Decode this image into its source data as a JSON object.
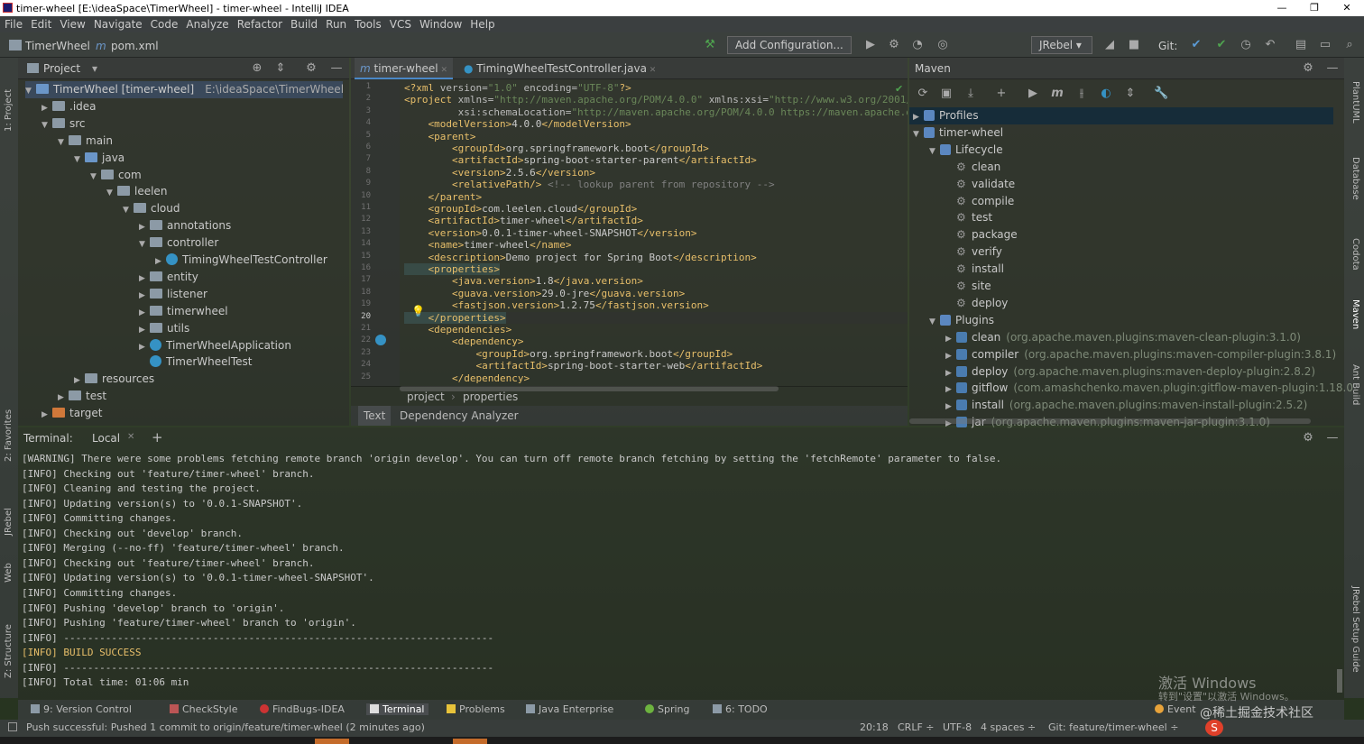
{
  "window": {
    "title": "timer-wheel [E:\\ideaSpace\\TimerWheel] - timer-wheel - IntelliJ IDEA"
  },
  "menu": [
    "File",
    "Edit",
    "View",
    "Navigate",
    "Code",
    "Analyze",
    "Refactor",
    "Build",
    "Run",
    "Tools",
    "VCS",
    "Window",
    "Help"
  ],
  "nav": {
    "project": "TimerWheel",
    "file": "pom.xml",
    "add_config": "Add Configuration...",
    "jrebel": "JRebel",
    "git_label": "Git:"
  },
  "project_panel": {
    "title": "Project",
    "rows": [
      {
        "depth": 0,
        "arrow": "▼",
        "icon": "module",
        "text": "TimerWheel [timer-wheel]",
        "extra": "E:\\ideaSpace\\TimerWheel"
      },
      {
        "depth": 1,
        "arrow": "▶",
        "icon": "folder",
        "text": ".idea",
        "extra": ""
      },
      {
        "depth": 1,
        "arrow": "▼",
        "icon": "folder",
        "text": "src",
        "extra": ""
      },
      {
        "depth": 2,
        "arrow": "▼",
        "icon": "folder",
        "text": "main",
        "extra": ""
      },
      {
        "depth": 3,
        "arrow": "▼",
        "icon": "blue",
        "text": "java",
        "extra": ""
      },
      {
        "depth": 4,
        "arrow": "▼",
        "icon": "folder",
        "text": "com",
        "extra": ""
      },
      {
        "depth": 5,
        "arrow": "▼",
        "icon": "folder",
        "text": "leelen",
        "extra": ""
      },
      {
        "depth": 6,
        "arrow": "▼",
        "icon": "folder",
        "text": "cloud",
        "extra": ""
      },
      {
        "depth": 7,
        "arrow": "▶",
        "icon": "folder",
        "text": "annotations",
        "extra": ""
      },
      {
        "depth": 7,
        "arrow": "▼",
        "icon": "folder",
        "text": "controller",
        "extra": ""
      },
      {
        "depth": 8,
        "arrow": "▶",
        "icon": "class",
        "text": "TimingWheelTestController",
        "extra": ""
      },
      {
        "depth": 7,
        "arrow": "▶",
        "icon": "folder",
        "text": "entity",
        "extra": ""
      },
      {
        "depth": 7,
        "arrow": "▶",
        "icon": "folder",
        "text": "listener",
        "extra": ""
      },
      {
        "depth": 7,
        "arrow": "▶",
        "icon": "folder",
        "text": "timerwheel",
        "extra": ""
      },
      {
        "depth": 7,
        "arrow": "▶",
        "icon": "folder",
        "text": "utils",
        "extra": ""
      },
      {
        "depth": 7,
        "arrow": "▶",
        "icon": "class",
        "text": "TimerWheelApplication",
        "extra": ""
      },
      {
        "depth": 7,
        "arrow": "",
        "icon": "class",
        "text": "TimerWheelTest",
        "extra": ""
      },
      {
        "depth": 3,
        "arrow": "▶",
        "icon": "folder",
        "text": "resources",
        "extra": ""
      },
      {
        "depth": 2,
        "arrow": "▶",
        "icon": "folder",
        "text": "test",
        "extra": ""
      },
      {
        "depth": 1,
        "arrow": "▶",
        "icon": "orange",
        "text": "target",
        "extra": ""
      }
    ]
  },
  "editor": {
    "tabs": [
      {
        "label": "timer-wheel",
        "active": true
      },
      {
        "label": "TimingWheelTestController.java",
        "active": false
      }
    ],
    "line_numbers": [
      "1",
      "2",
      "3",
      "4",
      "5",
      "6",
      "7",
      "8",
      "9",
      "10",
      "11",
      "12",
      "13",
      "14",
      "15",
      "16",
      "17",
      "18",
      "19",
      "20",
      "21",
      "22",
      "23",
      "24",
      "25"
    ],
    "lines": [
      [
        {
          "c": "tag",
          "t": "<?xml "
        },
        {
          "c": "attr",
          "t": "version="
        },
        {
          "c": "val",
          "t": "\"1.0\""
        },
        {
          "c": "attr",
          "t": " encoding="
        },
        {
          "c": "val",
          "t": "\"UTF-8\""
        },
        {
          "c": "tag",
          "t": "?>"
        }
      ],
      [
        {
          "c": "tag",
          "t": "<project "
        },
        {
          "c": "attr",
          "t": "xmlns="
        },
        {
          "c": "val",
          "t": "\"http://maven.apache.org/POM/4.0.0\""
        },
        {
          "c": "attr",
          "t": " xmlns:xsi="
        },
        {
          "c": "val",
          "t": "\"http://www.w3.org/2001/XMLS"
        }
      ],
      [
        {
          "c": "attr",
          "t": "         xsi:schemaLocation="
        },
        {
          "c": "val",
          "t": "\"http://maven.apache.org/POM/4.0.0 https://maven.apache.org/"
        }
      ],
      [
        {
          "c": "tag",
          "t": "    <modelVersion>"
        },
        {
          "c": "txt",
          "t": "4.0.0"
        },
        {
          "c": "tag",
          "t": "</modelVersion>"
        }
      ],
      [
        {
          "c": "tag",
          "t": "    <parent>"
        }
      ],
      [
        {
          "c": "tag",
          "t": "        <groupId>"
        },
        {
          "c": "txt",
          "t": "org.springframework.boot"
        },
        {
          "c": "tag",
          "t": "</groupId>"
        }
      ],
      [
        {
          "c": "tag",
          "t": "        <artifactId>"
        },
        {
          "c": "txt",
          "t": "spring-boot-starter-parent"
        },
        {
          "c": "tag",
          "t": "</artifactId>"
        }
      ],
      [
        {
          "c": "tag",
          "t": "        <version>"
        },
        {
          "c": "txt",
          "t": "2.5.6"
        },
        {
          "c": "tag",
          "t": "</version>"
        }
      ],
      [
        {
          "c": "tag",
          "t": "        <relativePath/>"
        },
        {
          "c": "cmt",
          "t": " <!-- lookup parent from repository -->"
        }
      ],
      [
        {
          "c": "tag",
          "t": "    </parent>"
        }
      ],
      [
        {
          "c": "tag",
          "t": "    <groupId>"
        },
        {
          "c": "txt",
          "t": "com.leelen.cloud"
        },
        {
          "c": "tag",
          "t": "</groupId>"
        }
      ],
      [
        {
          "c": "tag",
          "t": "    <artifactId>"
        },
        {
          "c": "txt",
          "t": "timer-wheel"
        },
        {
          "c": "tag",
          "t": "</artifactId>"
        }
      ],
      [
        {
          "c": "tag",
          "t": "    <version>"
        },
        {
          "c": "txt",
          "t": "0.0.1-timer-wheel-SNAPSHOT"
        },
        {
          "c": "tag",
          "t": "</version>"
        }
      ],
      [
        {
          "c": "tag",
          "t": "    <name>"
        },
        {
          "c": "txt",
          "t": "timer-wheel"
        },
        {
          "c": "tag",
          "t": "</name>"
        }
      ],
      [
        {
          "c": "tag",
          "t": "    <description>"
        },
        {
          "c": "txt",
          "t": "Demo project for Spring Boot"
        },
        {
          "c": "tag",
          "t": "</description>"
        }
      ],
      [
        {
          "c": "tag",
          "t": "    <properties>"
        }
      ],
      [
        {
          "c": "tag",
          "t": "        <java.version>"
        },
        {
          "c": "txt",
          "t": "1.8"
        },
        {
          "c": "tag",
          "t": "</java.version>"
        }
      ],
      [
        {
          "c": "tag",
          "t": "        <guava.version>"
        },
        {
          "c": "txt",
          "t": "29.0-jre"
        },
        {
          "c": "tag",
          "t": "</guava.version>"
        }
      ],
      [
        {
          "c": "tag",
          "t": "        <fastjson.version>"
        },
        {
          "c": "txt",
          "t": "1.2.75"
        },
        {
          "c": "tag",
          "t": "</fastjson.version>"
        }
      ],
      [
        {
          "c": "tag",
          "t": "    </properties>"
        }
      ],
      [
        {
          "c": "tag",
          "t": "    <dependencies>"
        }
      ],
      [
        {
          "c": "tag",
          "t": "        <dependency>"
        }
      ],
      [
        {
          "c": "tag",
          "t": "            <groupId>"
        },
        {
          "c": "txt",
          "t": "org.springframework.boot"
        },
        {
          "c": "tag",
          "t": "</groupId>"
        }
      ],
      [
        {
          "c": "tag",
          "t": "            <artifactId>"
        },
        {
          "c": "txt",
          "t": "spring-boot-starter-web"
        },
        {
          "c": "tag",
          "t": "</artifactId>"
        }
      ],
      [
        {
          "c": "tag",
          "t": "        </dependency>"
        }
      ]
    ],
    "breadcrumb": [
      "project",
      "properties"
    ],
    "bottom_tabs": [
      "Text",
      "Dependency Analyzer"
    ]
  },
  "maven": {
    "title": "Maven",
    "rows": [
      {
        "depth": 0,
        "arrow": "▶",
        "icon": "mvn",
        "text": "Profiles",
        "extra": ""
      },
      {
        "depth": 0,
        "arrow": "▼",
        "icon": "mvn",
        "text": "timer-wheel",
        "extra": ""
      },
      {
        "depth": 1,
        "arrow": "▼",
        "icon": "mvn",
        "text": "Lifecycle",
        "extra": ""
      },
      {
        "depth": 2,
        "arrow": "",
        "icon": "gear",
        "text": "clean",
        "extra": ""
      },
      {
        "depth": 2,
        "arrow": "",
        "icon": "gear",
        "text": "validate",
        "extra": ""
      },
      {
        "depth": 2,
        "arrow": "",
        "icon": "gear",
        "text": "compile",
        "extra": ""
      },
      {
        "depth": 2,
        "arrow": "",
        "icon": "gear",
        "text": "test",
        "extra": ""
      },
      {
        "depth": 2,
        "arrow": "",
        "icon": "gear",
        "text": "package",
        "extra": ""
      },
      {
        "depth": 2,
        "arrow": "",
        "icon": "gear",
        "text": "verify",
        "extra": ""
      },
      {
        "depth": 2,
        "arrow": "",
        "icon": "gear",
        "text": "install",
        "extra": ""
      },
      {
        "depth": 2,
        "arrow": "",
        "icon": "gear",
        "text": "site",
        "extra": ""
      },
      {
        "depth": 2,
        "arrow": "",
        "icon": "gear",
        "text": "deploy",
        "extra": ""
      },
      {
        "depth": 1,
        "arrow": "▼",
        "icon": "mvn",
        "text": "Plugins",
        "extra": ""
      },
      {
        "depth": 2,
        "arrow": "▶",
        "icon": "plug",
        "text": "clean",
        "extra": "(org.apache.maven.plugins:maven-clean-plugin:3.1.0)"
      },
      {
        "depth": 2,
        "arrow": "▶",
        "icon": "plug",
        "text": "compiler",
        "extra": "(org.apache.maven.plugins:maven-compiler-plugin:3.8.1)"
      },
      {
        "depth": 2,
        "arrow": "▶",
        "icon": "plug",
        "text": "deploy",
        "extra": "(org.apache.maven.plugins:maven-deploy-plugin:2.8.2)"
      },
      {
        "depth": 2,
        "arrow": "▶",
        "icon": "plug",
        "text": "gitflow",
        "extra": "(com.amashchenko.maven.plugin:gitflow-maven-plugin:1.18.0"
      },
      {
        "depth": 2,
        "arrow": "▶",
        "icon": "plug",
        "text": "install",
        "extra": "(org.apache.maven.plugins:maven-install-plugin:2.5.2)"
      },
      {
        "depth": 2,
        "arrow": "▶",
        "icon": "plug",
        "text": "jar",
        "extra": "(org.apache.maven.plugins:maven-jar-plugin:3.1.0)"
      }
    ]
  },
  "terminal": {
    "label": "Terminal:",
    "tab": "Local",
    "lines": [
      "[WARNING] There were some problems fetching remote branch 'origin develop'. You can turn off remote branch fetching by setting the 'fetchRemote' parameter to false.",
      "[INFO] Checking out 'feature/timer-wheel' branch.",
      "[INFO] Cleaning and testing the project.",
      "[INFO] Updating version(s) to '0.0.1-SNAPSHOT'.",
      "[INFO] Committing changes.",
      "[INFO] Checking out 'develop' branch.",
      "[INFO] Merging (--no-ff) 'feature/timer-wheel' branch.",
      "[INFO] Checking out 'feature/timer-wheel' branch.",
      "[INFO] Updating version(s) to '0.0.1-timer-wheel-SNAPSHOT'.",
      "[INFO] Committing changes.",
      "[INFO] Pushing 'develop' branch to 'origin'.",
      "[INFO] Pushing 'feature/timer-wheel' branch to 'origin'.",
      "[INFO] ------------------------------------------------------------------------",
      "[INFO] BUILD SUCCESS",
      "[INFO] ------------------------------------------------------------------------",
      "[INFO] Total time: 01:06 min"
    ]
  },
  "left_stripe": [
    "1: Project",
    "2: Favorites",
    "JRebel",
    "Web",
    "Z: Structure"
  ],
  "right_stripe": [
    "PlantUML",
    "Database",
    "Codota",
    "Maven",
    "Ant Build",
    "JRebel Setup Guide"
  ],
  "toolwindows": [
    "9: Version Control",
    "CheckStyle",
    "FindBugs-IDEA",
    "Terminal",
    "Problems",
    "Java Enterprise",
    "Spring",
    "6: TODO",
    "Event"
  ],
  "status": {
    "message": "Push successful: Pushed 1 commit to origin/feature/timer-wheel (2 minutes ago)",
    "position": "20:18",
    "line_sep": "CRLF ÷",
    "encoding": "UTF-8",
    "indent": "4 spaces ÷",
    "git": "Git: feature/timer-wheel ÷"
  },
  "watermark": {
    "line1": "激活 Windows",
    "line2": "转到\"设置\"以激活 Windows。",
    "site": "@稀土掘金技术社区"
  },
  "colors": {
    "tag": "#e8bf6a",
    "value": "#6a8759",
    "comment": "#808080",
    "success": "#e8bf6a"
  }
}
